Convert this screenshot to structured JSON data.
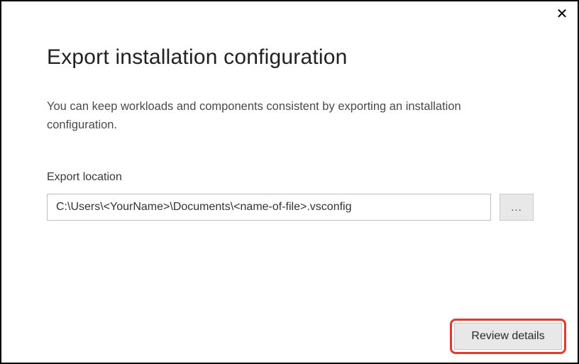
{
  "dialog": {
    "title": "Export installation configuration",
    "description": "You can keep workloads and components consistent by exporting an installation configuration.",
    "close_label": "✕"
  },
  "export": {
    "label": "Export location",
    "value": "C:\\Users\\<YourName>\\Documents\\<name-of-file>.vsconfig",
    "browse_label": "..."
  },
  "footer": {
    "review_label": "Review details"
  }
}
